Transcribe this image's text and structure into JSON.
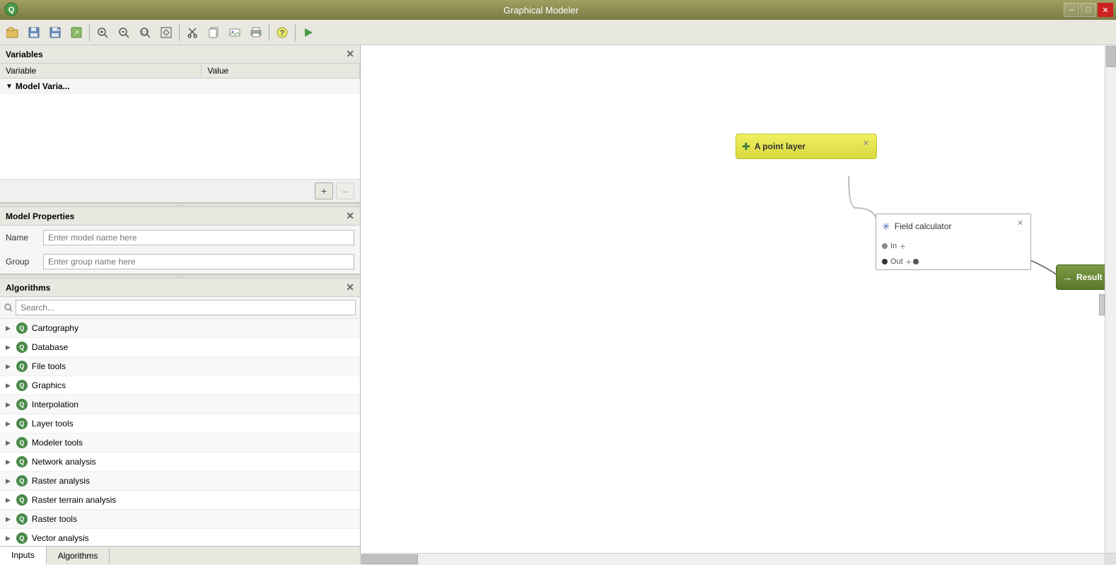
{
  "window": {
    "title": "Graphical Modeler"
  },
  "titlebar": {
    "title": "Graphical Modeler",
    "controls": {
      "minimize": "–",
      "maximize": "□",
      "close": "✕"
    }
  },
  "toolbar": {
    "buttons": [
      {
        "name": "open-folder-btn",
        "icon": "📂",
        "label": "Open"
      },
      {
        "name": "save-btn",
        "icon": "💾",
        "label": "Save"
      },
      {
        "name": "save-as-btn",
        "icon": "💾",
        "label": "Save As"
      },
      {
        "name": "export-btn",
        "icon": "📋",
        "label": "Export"
      },
      {
        "name": "zoom-in-btn",
        "icon": "🔍",
        "label": "Zoom In"
      },
      {
        "name": "zoom-out-btn",
        "icon": "🔍",
        "label": "Zoom Out"
      },
      {
        "name": "zoom-actual-btn",
        "icon": "🔍",
        "label": "Zoom Actual"
      },
      {
        "name": "zoom-fit-btn",
        "icon": "⊞",
        "label": "Zoom Fit"
      },
      {
        "name": "cut-btn",
        "icon": "✂",
        "label": "Cut"
      },
      {
        "name": "copy-btn",
        "icon": "📄",
        "label": "Copy"
      },
      {
        "name": "export-img-btn",
        "icon": "🖼",
        "label": "Export Image"
      },
      {
        "name": "print-btn",
        "icon": "🖨",
        "label": "Print"
      },
      {
        "name": "help-btn",
        "icon": "❓",
        "label": "Help"
      },
      {
        "name": "run-btn",
        "icon": "▶",
        "label": "Run",
        "color": "#4a9a4a"
      }
    ]
  },
  "variables": {
    "section_title": "Variables",
    "columns": [
      "Variable",
      "Value"
    ],
    "tree_item": "Model Varia..."
  },
  "model_properties": {
    "section_title": "Model Properties",
    "name_label": "Name",
    "name_placeholder": "Enter model name here",
    "group_label": "Group",
    "group_placeholder": "Enter group name here"
  },
  "algorithms": {
    "section_title": "Algorithms",
    "search_placeholder": "Search...",
    "items": [
      "Cartography",
      "Database",
      "File tools",
      "Graphics",
      "Interpolation",
      "Layer tools",
      "Modeler tools",
      "Network analysis",
      "Raster analysis",
      "Raster terrain analysis",
      "Raster tools",
      "Vector analysis"
    ]
  },
  "tabs": {
    "inputs": "Inputs",
    "algorithms": "Algorithms",
    "active": "Inputs"
  },
  "canvas": {
    "nodes": {
      "input_node": {
        "title": "A point layer",
        "type": "input",
        "icon": "+"
      },
      "process_node": {
        "title": "Field calculator",
        "type": "process",
        "port_in": "In",
        "port_out": "Out"
      },
      "output_node": {
        "title": "Result",
        "type": "output"
      }
    }
  }
}
